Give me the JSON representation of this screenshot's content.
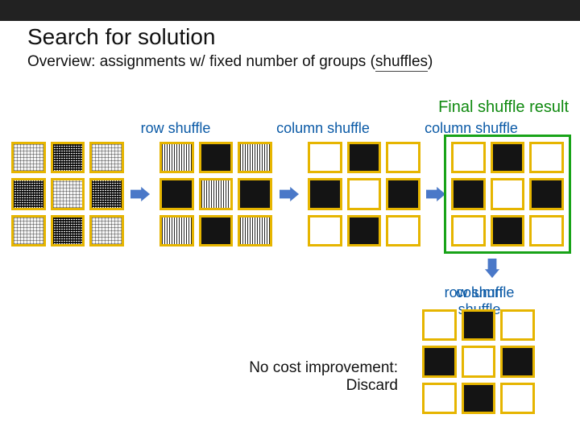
{
  "title": "Search for solution",
  "subtitle_lead": "Overview: assignments w/ fixed number of groups (",
  "subtitle_keyword": "shuffles",
  "subtitle_tail": ")",
  "final_label": "Final shuffle result",
  "labels": {
    "row": "row shuffle",
    "col1": "column shuffle",
    "col2": "column shuffle",
    "extra_over1": "row shuffle",
    "extra_over2": "column shuffle"
  },
  "discard_line1": "No cost improvement:",
  "discard_line2": "Discard",
  "grids": {
    "g1": [
      "noise-light",
      "noise",
      "noise-light",
      "noise",
      "noise-light",
      "noise",
      "noise-light",
      "noise",
      "noise-light"
    ],
    "g2": [
      "stripes",
      "dark",
      "stripes",
      "dark",
      "stripes",
      "dark",
      "stripes",
      "dark",
      "stripes"
    ],
    "g3": [
      "",
      "dark",
      "",
      "dark",
      "",
      "dark",
      "",
      "dark",
      ""
    ],
    "g4": [
      "",
      "dark",
      "",
      "dark",
      "",
      "dark",
      "",
      "dark",
      ""
    ],
    "g5": [
      "",
      "dark",
      "",
      "dark",
      "",
      "dark",
      "",
      "dark",
      ""
    ]
  }
}
